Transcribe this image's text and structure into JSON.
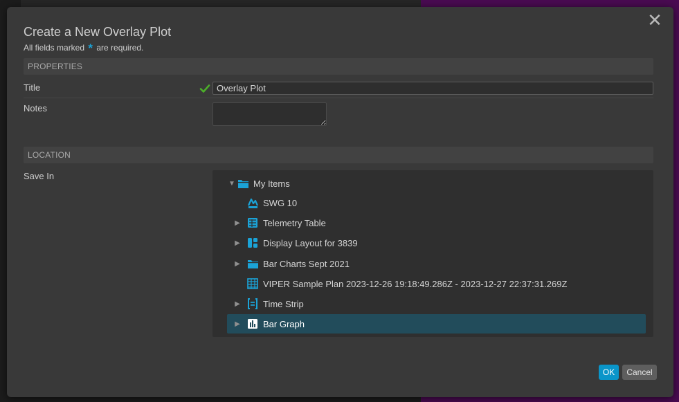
{
  "dialog": {
    "title": "Create a New Overlay Plot",
    "required_note_pre": "All fields marked",
    "required_note_post": "are required.",
    "close_glyph": "✕"
  },
  "properties": {
    "header": "PROPERTIES",
    "title_label": "Title",
    "title_value": "Overlay Plot",
    "notes_label": "Notes",
    "notes_value": ""
  },
  "location": {
    "header": "LOCATION",
    "save_in_label": "Save In",
    "tree": [
      {
        "label": "My Items",
        "icon": "folder-icon",
        "expander": "expanded",
        "level": 0
      },
      {
        "label": "SWG 10",
        "icon": "swg-icon",
        "expander": "none",
        "level": 1
      },
      {
        "label": "Telemetry Table",
        "icon": "telemetry-table-icon",
        "expander": "collapsed",
        "level": 1
      },
      {
        "label": "Display Layout for 3839",
        "icon": "display-layout-icon",
        "expander": "collapsed",
        "level": 1
      },
      {
        "label": "Bar Charts Sept 2021",
        "icon": "folder-icon",
        "expander": "collapsed",
        "level": 1
      },
      {
        "label": "VIPER Sample Plan 2023-12-26 19:18:49.286Z - 2023-12-27 22:37:31.269Z",
        "icon": "plan-table-icon",
        "expander": "none",
        "level": 1
      },
      {
        "label": "Time Strip",
        "icon": "time-strip-icon",
        "expander": "collapsed",
        "level": 1
      },
      {
        "label": "Bar Graph",
        "icon": "bar-graph-icon",
        "expander": "collapsed",
        "level": 1,
        "selected": true
      }
    ]
  },
  "buttons": {
    "ok": "OK",
    "cancel": "Cancel"
  },
  "colors": {
    "accent": "#0a95c9",
    "icon_blue": "#1ba3d7",
    "selected_row": "#224c5b",
    "valid_check": "#4caf2a",
    "dialog_bg": "#393939"
  }
}
